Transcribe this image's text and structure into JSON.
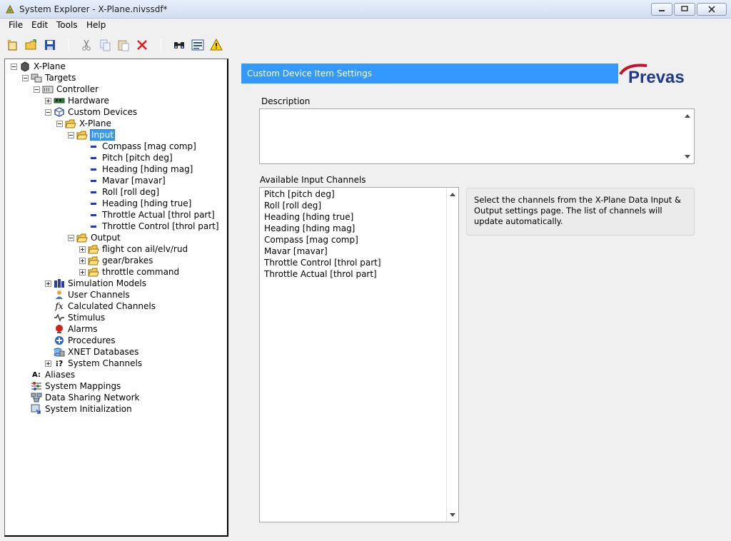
{
  "window": {
    "title": "System Explorer - X-Plane.nivssdf*"
  },
  "menu": {
    "file": "File",
    "edit": "Edit",
    "tools": "Tools",
    "help": "Help"
  },
  "tree": {
    "root": "X-Plane",
    "targets": "Targets",
    "controller": "Controller",
    "hardware": "Hardware",
    "custom_devices": "Custom Devices",
    "xplane_device": "X-Plane",
    "input": "Input",
    "input_channels": [
      "Compass [mag comp]",
      "Pitch [pitch deg]",
      "Heading [hding mag]",
      "Mavar [mavar]",
      "Roll [roll deg]",
      "Heading [hding true]",
      "Throttle Actual [throl part]",
      "Throttle Control [throl part]"
    ],
    "output": "Output",
    "output_folders": [
      "flight con ail/elv/rud",
      "gear/brakes",
      "throttle command"
    ],
    "simulation_models": "Simulation Models",
    "user_channels": "User Channels",
    "calculated_channels": "Calculated Channels",
    "stimulus": "Stimulus",
    "alarms": "Alarms",
    "procedures": "Procedures",
    "xnet_databases": "XNET Databases",
    "system_channels": "System Channels",
    "aliases": "Aliases",
    "system_mappings": "System Mappings",
    "data_sharing_network": "Data Sharing Network",
    "system_initialization": "System Initialization"
  },
  "panel": {
    "header": "Custom Device Item Settings",
    "logo_text": "Prevas",
    "description_label": "Description",
    "description_value": "",
    "channels_label": "Available Input Channels",
    "channels": [
      "Pitch [pitch deg]",
      "Roll [roll deg]",
      "Heading [hding true]",
      "Heading [hding mag]",
      "Compass [mag comp]",
      "Mavar [mavar]",
      "Throttle Control [throl part]",
      "Throttle Actual [throl part]"
    ],
    "hint": "Select the channels from the X-Plane Data Input & Output settings page. The list of channels will update automatically."
  },
  "colors": {
    "accent": "#3399ff",
    "logo_blue": "#1f3a8a",
    "logo_red": "#c8102e"
  }
}
